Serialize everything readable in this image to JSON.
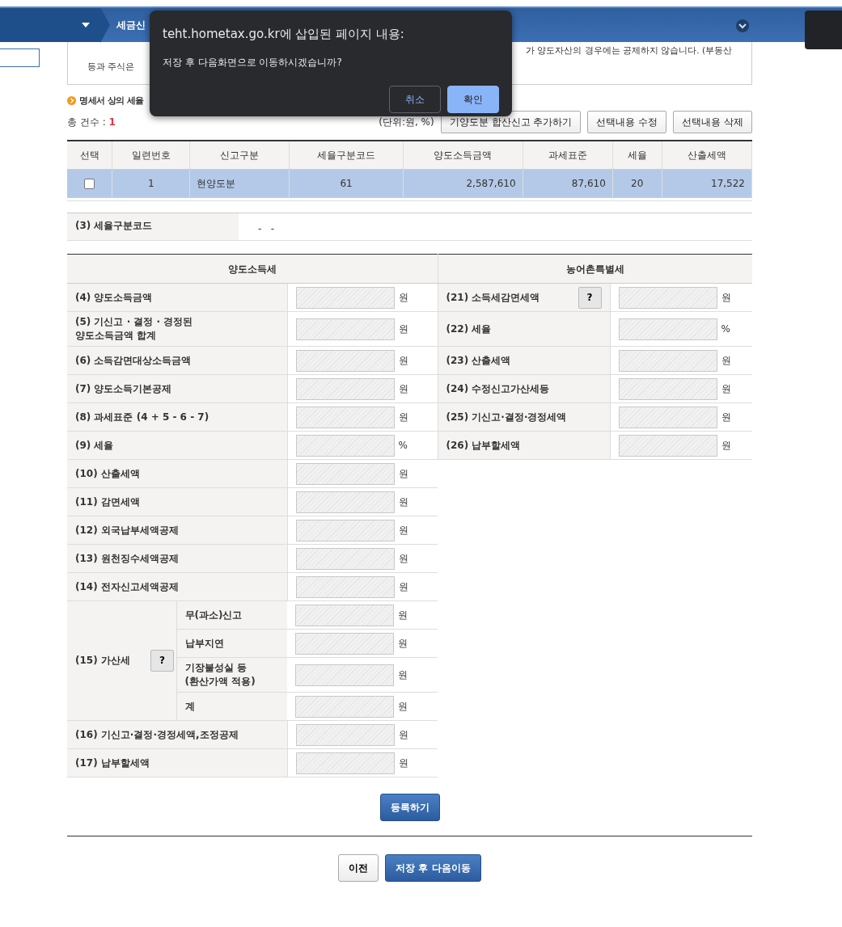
{
  "header": {
    "breadcrumb": "세금신"
  },
  "notice": {
    "lines": [
      "가 양도자산의 경우에는 공제하지 않습니다. (부동산",
      "등과 주식은"
    ]
  },
  "dialog": {
    "title": "teht.hometax.go.kr에 삽입된 페이지 내용:",
    "message": "저장 후 다음화면으로 이동하시겠습니까?",
    "buttons": [
      {
        "label": "취소",
        "kind": "secondary"
      },
      {
        "label": "확인",
        "kind": "primary"
      }
    ]
  },
  "section_title": "명세서 상의 세율",
  "count": {
    "label": "총 건수 :",
    "value": "1"
  },
  "unit_note": "(단위:원, %)",
  "actions": [
    "기양도분 합산신고 추가하기",
    "선택내용 수정",
    "선택내용 삭제"
  ],
  "list": {
    "columns": [
      "선택",
      "일련번호",
      "신고구분",
      "세율구분코드",
      "양도소득금액",
      "과세표준",
      "세율",
      "산출세액"
    ],
    "rows": [
      {
        "checked": false,
        "highlighted": true,
        "cells": [
          "",
          "1",
          "현양도분",
          "61",
          "2,587,610",
          "87,610",
          "20",
          "17,522"
        ]
      }
    ]
  },
  "code_field": {
    "label": "(3) 세율구분코드",
    "value": "-   -"
  },
  "form": {
    "headers": [
      "양도소득세",
      "농어촌특별세"
    ],
    "rows": [
      {
        "left": {
          "label": "(4) 양도소득금액",
          "unit": "원"
        },
        "right": {
          "label": "(21) 소득세감면세액",
          "unit": "원",
          "help": "?"
        }
      },
      {
        "left": {
          "label": "(5) 기신고 · 결정 · 경정된\n양도소득금액 합계",
          "unit": "원"
        },
        "right": {
          "label": "(22) 세율",
          "unit": "%"
        }
      },
      {
        "left": {
          "label": "(6) 소득감면대상소득금액",
          "unit": "원"
        },
        "right": {
          "label": "(23) 산출세액",
          "unit": "원"
        }
      },
      {
        "left": {
          "label": "(7) 양도소득기본공제",
          "unit": "원"
        },
        "right": {
          "label": "(24) 수정신고가산세등",
          "unit": "원"
        }
      },
      {
        "left": {
          "label": "(8) 과세표준 (4 + 5 - 6 - 7)",
          "unit": "원"
        },
        "right": {
          "label": "(25) 기신고·결정·경정세액",
          "unit": "원"
        }
      },
      {
        "left": {
          "label": "(9) 세율",
          "unit": "%"
        },
        "right": {
          "label": "(26) 납부할세액",
          "unit": "원"
        }
      },
      {
        "left": {
          "label": "(10) 산출세액",
          "unit": "원"
        }
      },
      {
        "left": {
          "label": "(11) 감면세액",
          "unit": "원"
        }
      },
      {
        "left": {
          "label": "(12) 외국납부세액공제",
          "unit": "원"
        }
      },
      {
        "left": {
          "label": "(13) 원천징수세액공제",
          "unit": "원"
        }
      },
      {
        "left": {
          "label": "(14) 전자신고세액공제",
          "unit": "원"
        }
      },
      {
        "left": {
          "label": "(15) 가산세",
          "help": "?",
          "subrows": [
            {
              "label": "무(과소)신고",
              "unit": "원"
            },
            {
              "label": "납부지연",
              "unit": "원"
            },
            {
              "label": "기장불성실 등\n(환산가액 적용)",
              "unit": "원"
            },
            {
              "label": "계",
              "unit": "원"
            }
          ]
        }
      },
      {
        "left": {
          "label": "(16) 기신고·결정·경정세액,조정공제",
          "unit": "원"
        }
      },
      {
        "left": {
          "label": "(17) 납부할세액",
          "unit": "원"
        }
      }
    ]
  },
  "register_button": "등록하기",
  "nav_buttons": [
    {
      "label": "이전",
      "kind": "secondary"
    },
    {
      "label": "저장 후 다음이동",
      "kind": "primary"
    }
  ]
}
